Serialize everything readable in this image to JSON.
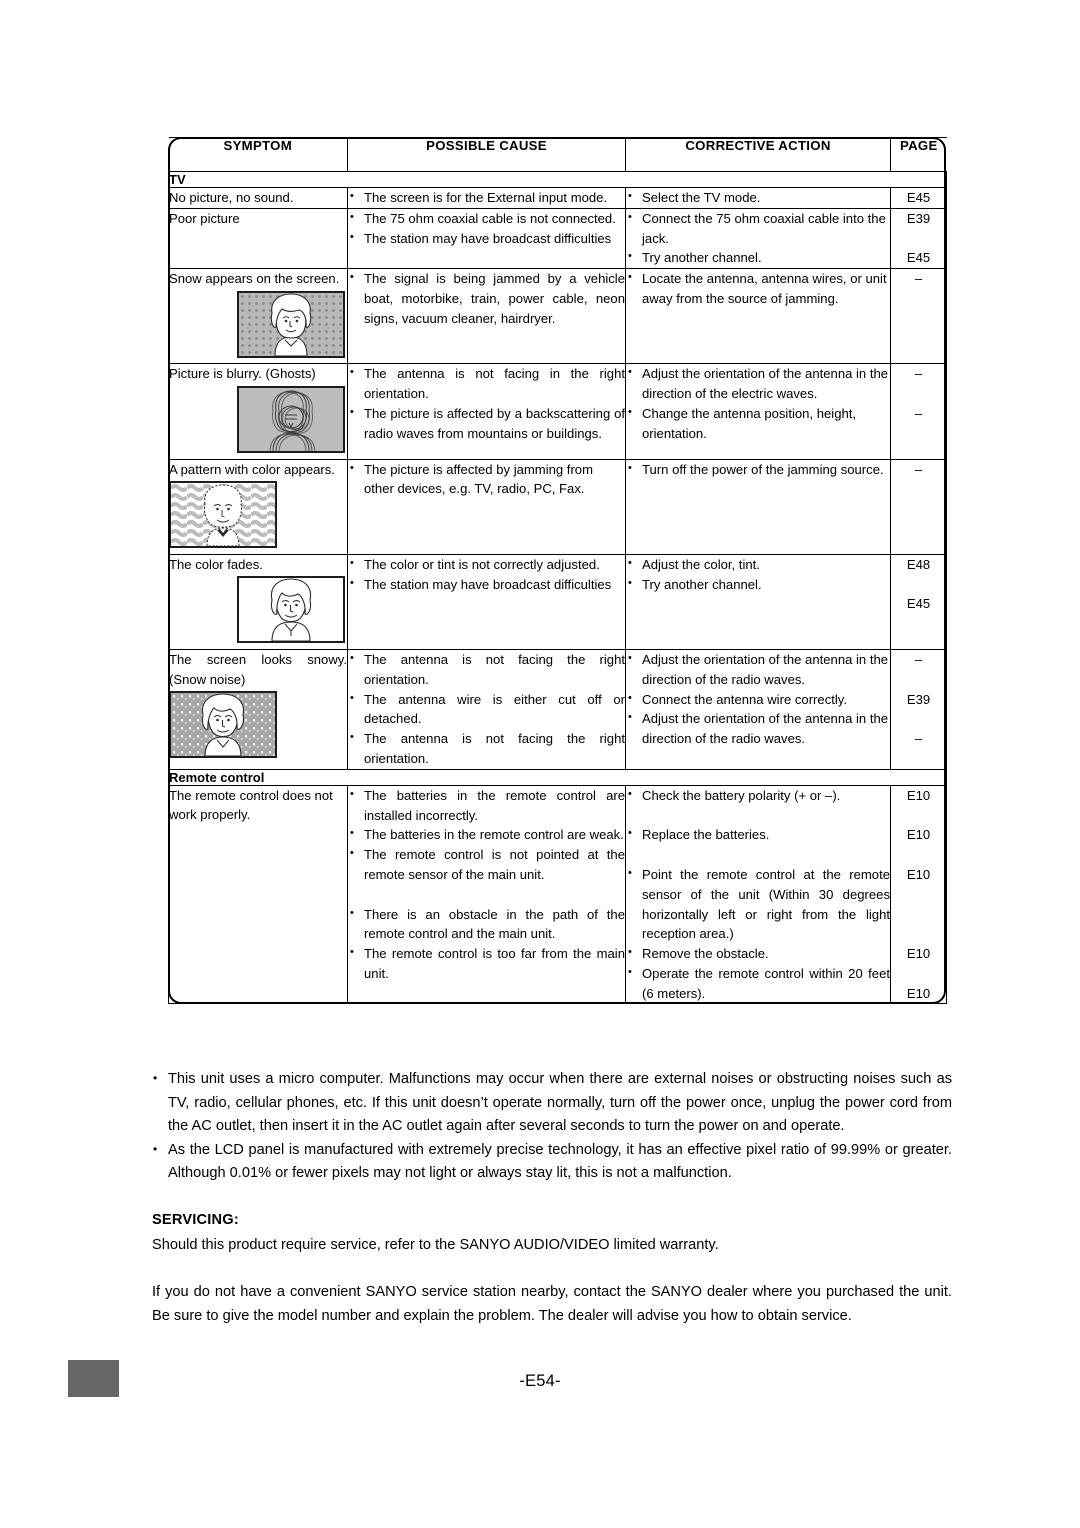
{
  "page": {
    "footer_page_label": "-E54-",
    "footer_marker_color": "#666666"
  },
  "table": {
    "headers": {
      "symptom": "SYMPTOM",
      "possible_cause": "POSSIBLE CAUSE",
      "corrective_action": "CORRECTIVE ACTION",
      "page": "PAGE"
    },
    "groups": [
      {
        "label": "TV"
      },
      {
        "label": "Remote control"
      }
    ],
    "rows": [
      {
        "group": "TV",
        "symptom": "No picture, no sound.",
        "picture": null,
        "causes": [
          "The screen is for the External input mode."
        ],
        "actions": [
          "Select the TV mode."
        ],
        "pages": [
          "E45"
        ]
      },
      {
        "group": "TV",
        "symptom": "Poor picture",
        "picture": null,
        "causes": [
          "The 75 ohm coaxial cable is not connected.",
          "The station may have broadcast difficulties"
        ],
        "actions": [
          "Connect the 75 ohm coaxial cable into the jack.",
          "Try another channel."
        ],
        "pages": [
          "E39",
          "E45"
        ]
      },
      {
        "group": "TV",
        "symptom": "Snow appears on the screen.",
        "picture": "tv-snow-dotted",
        "causes": [
          "The signal is being jammed by a vehicle boat, motorbike, train, power cable, neon signs, vacuum cleaner, hairdryer."
        ],
        "actions": [
          "Locate the antenna, antenna wires, or unit away from the source of jamming."
        ],
        "pages": [
          "–"
        ]
      },
      {
        "group": "TV",
        "symptom": "Picture is blurry. (Ghosts)",
        "picture": "tv-ghost",
        "causes": [
          "The antenna is not facing in the right orientation.",
          "The picture is affected by a backscattering of radio waves from mountains or buildings."
        ],
        "actions": [
          "Adjust the orientation of the antenna in the direction of the electric waves.",
          "Change the antenna position, height, orientation."
        ],
        "pages": [
          "–",
          "–"
        ]
      },
      {
        "group": "TV",
        "symptom": "A pattern with color appears.",
        "picture": "tv-wavy-pattern",
        "causes": [
          "The picture is affected by jamming from other devices, e.g. TV, radio, PC, Fax."
        ],
        "actions": [
          "Turn off the power of the jamming source."
        ],
        "pages": [
          "–"
        ]
      },
      {
        "group": "TV",
        "symptom": "The color fades.",
        "picture": "tv-plain",
        "causes": [
          "The color or tint is not correctly adjusted.",
          "The station may have broadcast difficulties"
        ],
        "actions": [
          "Adjust the color, tint.",
          "Try another channel."
        ],
        "pages": [
          "E48",
          "E45"
        ]
      },
      {
        "group": "TV",
        "symptom": "The screen looks snowy. (Snow noise)",
        "picture": "tv-snow-noise",
        "causes": [
          "The antenna is not facing the right orientation.",
          "The antenna wire is either cut off or detached.",
          "The antenna is not facing the right orientation."
        ],
        "actions": [
          "Adjust the orientation of the antenna in the direction of the radio waves.",
          "Connect the antenna wire correctly.",
          "Adjust the orientation of the antenna in the direction of the radio waves."
        ],
        "pages": [
          "–",
          "E39",
          "–"
        ]
      },
      {
        "group": "Remote control",
        "symptom": "The remote control does not work properly.",
        "picture": null,
        "causes": [
          "The batteries in the remote control are installed incorrectly.",
          "The batteries in the remote control are weak.",
          "The remote control is not pointed at the remote sensor of the main unit.",
          "There is an obstacle in the path of the remote control and the main unit.",
          "The remote control is too far from the main unit."
        ],
        "actions": [
          "Check the battery polarity (+ or –).",
          "Replace the batteries.",
          "Point the remote control at the remote sensor of the unit (Within 30 degrees horizontally left or right from the light reception area.)",
          "Remove the obstacle.",
          "Operate the remote control within 20 feet (6 meters)."
        ],
        "pages": [
          "E10",
          "E10",
          "E10",
          "E10",
          "E10"
        ]
      }
    ]
  },
  "notes": [
    "This unit uses a micro computer. Malfunctions may occur when there are external noises or obstructing noises such as TV, radio, cellular phones, etc. If this unit doesn’t operate normally, turn off the power once, unplug the power cord from the AC outlet, then insert it in the AC outlet again after several seconds to turn the power on and operate.",
    "As the LCD panel is manufactured with extremely precise technology, it has an effective pixel ratio of 99.99% or greater. Although 0.01% or fewer pixels may not light or always stay lit, this is not a malfunction."
  ],
  "servicing": {
    "heading": "SERVICING:",
    "paragraph1": "Should this product require service, refer to the SANYO AUDIO/VIDEO limited warranty.",
    "paragraph2": "If you do not have a convenient SANYO service station nearby, contact the SANYO dealer where you purchased the unit. Be sure to give the model number and explain the problem. The dealer will advise you how to obtain service."
  }
}
